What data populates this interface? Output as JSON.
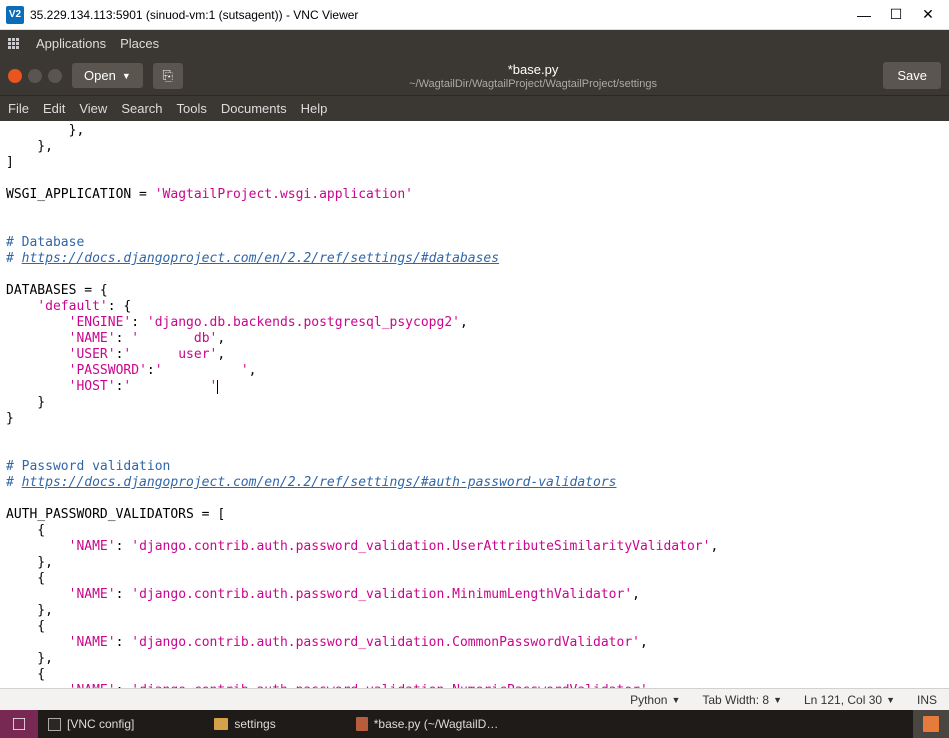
{
  "vnc": {
    "icon": "V2",
    "title": "35.229.134.113:5901 (sinuod-vm:1 (sutsagent)) - VNC Viewer",
    "min": "—",
    "max": "☐",
    "close": "✕"
  },
  "gnome": {
    "apps": "Applications",
    "places": "Places"
  },
  "gedit": {
    "open": "Open",
    "caret": "▼",
    "newdoc": "⎘",
    "title": "*base.py",
    "subtitle": "~/WagtailDir/WagtailProject/WagtailProject/settings",
    "save": "Save",
    "menus": [
      "File",
      "Edit",
      "View",
      "Search",
      "Tools",
      "Documents",
      "Help"
    ]
  },
  "code": {
    "l01": "        },",
    "l02": "    },",
    "l03": "]",
    "l04": "",
    "l05a": "WSGI_APPLICATION = ",
    "l05b": "'WagtailProject.wsgi.application'",
    "l06": "",
    "l07": "",
    "l08": "# Database",
    "l09a": "# ",
    "l09b": "https://docs.djangoproject.com/en/2.2/ref/settings/#databases",
    "l10": "",
    "l11": "DATABASES = {",
    "l12a": "    ",
    "l12b": "'default'",
    "l12c": ": {",
    "l13a": "        ",
    "l13b": "'ENGINE'",
    "l13c": ": ",
    "l13d": "'django.db.backends.postgresql_psycopg2'",
    "l13e": ",",
    "l14a": "        ",
    "l14b": "'NAME'",
    "l14c": ": ",
    "l14d": "'       db'",
    "l14e": ",",
    "l15a": "        ",
    "l15b": "'USER'",
    "l15c": ":",
    "l15d": "'      user'",
    "l15e": ",",
    "l16a": "        ",
    "l16b": "'PASSWORD'",
    "l16c": ":",
    "l16d": "'          '",
    "l16e": ",",
    "l17a": "        ",
    "l17b": "'HOST'",
    "l17c": ":",
    "l17d": "'          '",
    "l18": "    }",
    "l19": "}",
    "l20": "",
    "l21": "",
    "l22": "# Password validation",
    "l23a": "# ",
    "l23b": "https://docs.djangoproject.com/en/2.2/ref/settings/#auth-password-validators",
    "l24": "",
    "l25": "AUTH_PASSWORD_VALIDATORS = [",
    "l26": "    {",
    "l27a": "        ",
    "l27b": "'NAME'",
    "l27c": ": ",
    "l27d": "'django.contrib.auth.password_validation.UserAttributeSimilarityValidator'",
    "l27e": ",",
    "l28": "    },",
    "l29": "    {",
    "l30a": "        ",
    "l30b": "'NAME'",
    "l30c": ": ",
    "l30d": "'django.contrib.auth.password_validation.MinimumLengthValidator'",
    "l30e": ",",
    "l31": "    },",
    "l32": "    {",
    "l33a": "        ",
    "l33b": "'NAME'",
    "l33c": ": ",
    "l33d": "'django.contrib.auth.password_validation.CommonPasswordValidator'",
    "l33e": ",",
    "l34": "    },",
    "l35": "    {",
    "l36a": "        ",
    "l36b": "'NAME'",
    "l36c": ": ",
    "l36d": "'django.contrib.auth.password_validation.NumericPasswordValidator'",
    "l36e": ",",
    "l37": "    },"
  },
  "status": {
    "lang": "Python",
    "tab": "Tab Width: 8",
    "pos": "Ln 121, Col 30",
    "ins": "INS",
    "caret": "▼"
  },
  "taskbar": {
    "vnc": "[VNC config]",
    "settings": "settings",
    "base": "*base.py (~/WagtailD…"
  }
}
